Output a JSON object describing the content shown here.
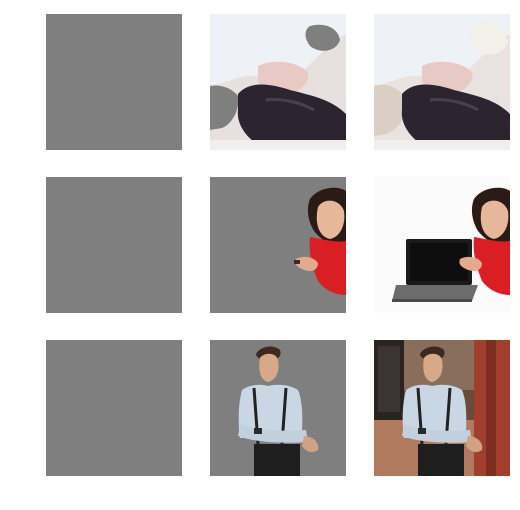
{
  "grid": {
    "columns": [
      "blank-mask",
      "masked-foreground",
      "original-image"
    ],
    "rows": [
      {
        "subject": "woman-lying-down"
      },
      {
        "subject": "woman-with-laptop"
      },
      {
        "subject": "man-with-suspenders"
      }
    ]
  },
  "colors": {
    "mask_gray": "#7f7f7f",
    "background": "#ffffff"
  }
}
